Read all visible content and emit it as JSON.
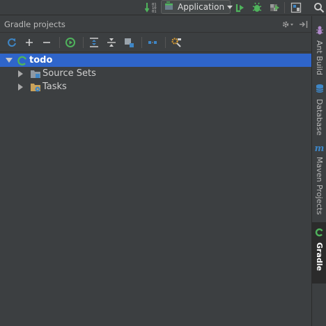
{
  "toolbar": {
    "run_config_label": "Application",
    "sort_digits_top": "01",
    "sort_digits_mid": "10",
    "sort_digits_bot": "01"
  },
  "tool_window": {
    "title": "Gradle projects"
  },
  "tree": {
    "root": {
      "label": "todo",
      "expanded": true
    },
    "children": [
      {
        "label": "Source Sets",
        "expanded": false
      },
      {
        "label": "Tasks",
        "expanded": false
      }
    ]
  },
  "right_stripe": {
    "items": [
      {
        "label": "Ant Build"
      },
      {
        "label": "Database"
      },
      {
        "label": "Maven Projects"
      },
      {
        "label": "Gradle"
      }
    ]
  },
  "colors": {
    "background": "#3c3f41",
    "selection": "#2f65ca",
    "accent_green": "#4fb35c",
    "accent_blue": "#3e86c6"
  }
}
